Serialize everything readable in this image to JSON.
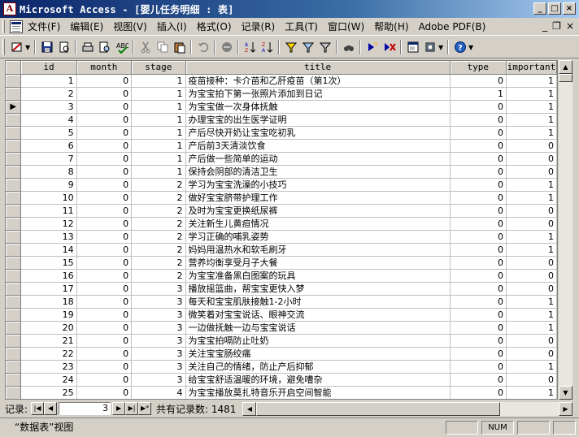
{
  "window": {
    "app_icon_letter": "A",
    "title": "Microsoft Access - [婴儿任务明细 : 表]",
    "minimize": "_",
    "maximize": "□",
    "close": "×"
  },
  "menu": {
    "items": [
      "文件(F)",
      "编辑(E)",
      "视图(V)",
      "插入(I)",
      "格式(O)",
      "记录(R)",
      "工具(T)",
      "窗口(W)",
      "帮助(H)",
      "Adobe PDF(B)"
    ],
    "doc_minimize": "_",
    "doc_restore": "❐",
    "doc_close": "×"
  },
  "table": {
    "columns": [
      "id",
      "month",
      "stage",
      "title",
      "type",
      "important"
    ],
    "current_row_marker": "▶",
    "current_row_index": 2,
    "rows": [
      {
        "id": "1",
        "month": "0",
        "stage": "1",
        "title": "疫苗接种：卡介苗和乙肝疫苗（第1次）",
        "type": "0",
        "important": "1"
      },
      {
        "id": "2",
        "month": "0",
        "stage": "1",
        "title": "为宝宝拍下第一张照片添加到日记",
        "type": "1",
        "important": "1"
      },
      {
        "id": "3",
        "month": "0",
        "stage": "1",
        "title": "为宝宝做一次身体抚触",
        "type": "0",
        "important": "1"
      },
      {
        "id": "4",
        "month": "0",
        "stage": "1",
        "title": "办理宝宝的出生医学证明",
        "type": "0",
        "important": "1"
      },
      {
        "id": "5",
        "month": "0",
        "stage": "1",
        "title": "产后尽快开奶让宝宝吃初乳",
        "type": "0",
        "important": "1"
      },
      {
        "id": "6",
        "month": "0",
        "stage": "1",
        "title": "产后前3天清淡饮食",
        "type": "0",
        "important": "0"
      },
      {
        "id": "7",
        "month": "0",
        "stage": "1",
        "title": "产后做一些简单的运动",
        "type": "0",
        "important": "0"
      },
      {
        "id": "8",
        "month": "0",
        "stage": "1",
        "title": "保持会阴部的清洁卫生",
        "type": "0",
        "important": "0"
      },
      {
        "id": "9",
        "month": "0",
        "stage": "2",
        "title": "学习为宝宝洗澡的小技巧",
        "type": "0",
        "important": "1"
      },
      {
        "id": "10",
        "month": "0",
        "stage": "2",
        "title": "做好宝宝脐带护理工作",
        "type": "0",
        "important": "1"
      },
      {
        "id": "11",
        "month": "0",
        "stage": "2",
        "title": "及时为宝宝更换纸尿裤",
        "type": "0",
        "important": "0"
      },
      {
        "id": "12",
        "month": "0",
        "stage": "2",
        "title": "关注新生儿黄疸情况",
        "type": "0",
        "important": "0"
      },
      {
        "id": "13",
        "month": "0",
        "stage": "2",
        "title": "学习正确的哺乳姿势",
        "type": "0",
        "important": "1"
      },
      {
        "id": "14",
        "month": "0",
        "stage": "2",
        "title": "妈妈用温热水和软毛刷牙",
        "type": "0",
        "important": "1"
      },
      {
        "id": "15",
        "month": "0",
        "stage": "2",
        "title": "营养均衡享受月子大餐",
        "type": "0",
        "important": "0"
      },
      {
        "id": "16",
        "month": "0",
        "stage": "2",
        "title": "为宝宝准备黑白图案的玩具",
        "type": "0",
        "important": "0"
      },
      {
        "id": "17",
        "month": "0",
        "stage": "3",
        "title": "播放摇篮曲，帮宝宝更快入梦",
        "type": "0",
        "important": "0"
      },
      {
        "id": "18",
        "month": "0",
        "stage": "3",
        "title": "每天和宝宝肌肤接触1-2小时",
        "type": "0",
        "important": "1"
      },
      {
        "id": "19",
        "month": "0",
        "stage": "3",
        "title": "微笑着对宝宝说话、眼神交流",
        "type": "0",
        "important": "1"
      },
      {
        "id": "20",
        "month": "0",
        "stage": "3",
        "title": "一边做抚触一边与宝宝说话",
        "type": "0",
        "important": "1"
      },
      {
        "id": "21",
        "month": "0",
        "stage": "3",
        "title": "为宝宝拍嗝防止吐奶",
        "type": "0",
        "important": "0"
      },
      {
        "id": "22",
        "month": "0",
        "stage": "3",
        "title": "关注宝宝肠绞痛",
        "type": "0",
        "important": "0"
      },
      {
        "id": "23",
        "month": "0",
        "stage": "3",
        "title": "关注自己的情绪，防止产后抑郁",
        "type": "0",
        "important": "1"
      },
      {
        "id": "24",
        "month": "0",
        "stage": "3",
        "title": "给宝宝舒适温暖的环境，避免嘈杂",
        "type": "0",
        "important": "0"
      },
      {
        "id": "25",
        "month": "0",
        "stage": "4",
        "title": "为宝宝播放莫扎特音乐开启空间智能",
        "type": "0",
        "important": "1"
      }
    ]
  },
  "navigator": {
    "label": "记录:",
    "first": "|◀",
    "prev": "◀",
    "current": "3",
    "next": "▶",
    "last": "▶|",
    "new": "▶*",
    "total_text": "共有记录数: 1481"
  },
  "status": {
    "view": "“数据表”视图",
    "num": "NUM"
  },
  "colors": {
    "titlebar_start": "#0a246a",
    "titlebar_end": "#a6caf0",
    "chrome": "#d4d0c8"
  }
}
